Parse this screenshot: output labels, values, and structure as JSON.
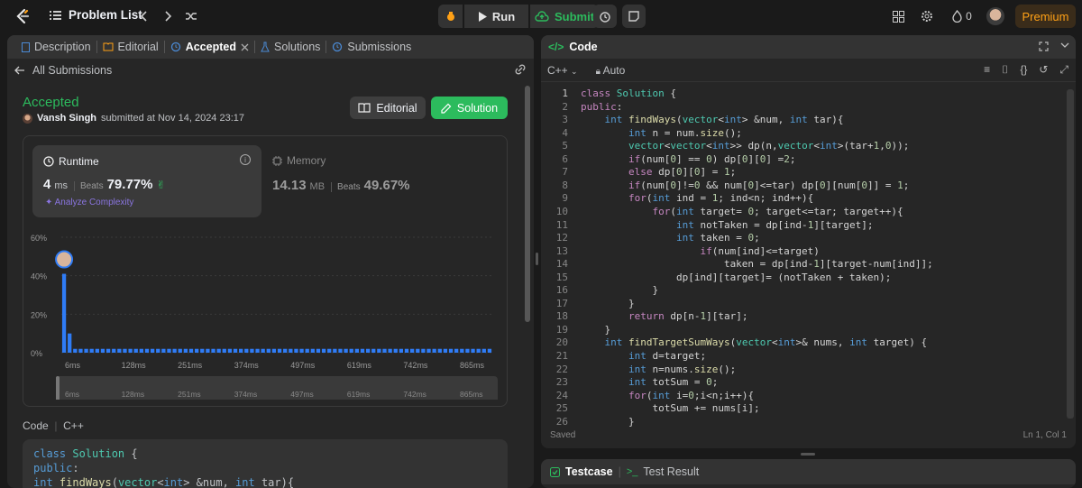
{
  "topbar": {
    "problem_list": "Problem List",
    "run": "Run",
    "submit": "Submit",
    "points": "0",
    "premium": "Premium"
  },
  "left": {
    "tabs": [
      "Description",
      "Editorial",
      "Accepted",
      "Solutions",
      "Submissions"
    ],
    "back_label": "All Submissions",
    "status": "Accepted",
    "user": "Vansh Singh",
    "submitted": "submitted at Nov 14, 2024 23:17",
    "editorial_btn": "Editorial",
    "solution_btn": "Solution",
    "runtime": {
      "title": "Runtime",
      "value": "4",
      "unit": "ms",
      "beats_label": "Beats",
      "beats": "79.77%",
      "analyze": "Analyze Complexity"
    },
    "memory": {
      "title": "Memory",
      "value": "14.13",
      "unit": "MB",
      "beats_label": "Beats",
      "beats": "49.67%"
    },
    "code_label": "Code",
    "code_lang": "C++",
    "code_preview": [
      "class Solution {",
      "public:",
      "    int findWays(vector<int> &num, int tar){"
    ]
  },
  "chart_data": {
    "type": "bar",
    "ylabels": [
      "60%",
      "40%",
      "20%",
      "0%"
    ],
    "ylim": [
      0,
      60
    ],
    "xlabels": [
      "6ms",
      "128ms",
      "251ms",
      "374ms",
      "497ms",
      "619ms",
      "742ms",
      "865ms"
    ],
    "values": [
      41,
      10,
      2,
      2,
      2,
      2,
      2,
      2,
      2,
      2,
      2,
      2,
      2,
      2,
      2,
      2,
      2,
      2,
      2,
      2,
      2,
      2,
      2,
      2,
      2,
      2,
      2,
      2,
      2,
      2,
      2,
      2,
      2,
      2,
      2,
      2,
      2,
      2,
      2,
      2,
      2,
      2,
      2,
      2,
      2,
      2,
      2,
      2,
      2,
      2,
      2,
      2,
      2,
      2,
      2,
      2,
      2,
      2,
      2,
      2,
      2,
      2,
      2,
      2,
      2,
      2,
      2,
      2,
      2,
      2,
      2,
      2,
      2,
      2,
      2,
      2,
      2,
      2
    ],
    "highlight_index": 0
  },
  "right": {
    "title": "Code",
    "lang": "C++",
    "auto": "Auto",
    "saved": "Saved",
    "cursor": "Ln 1, Col 1",
    "testcase": "Testcase",
    "test_result": "Test Result"
  },
  "code_lines": [
    "class Solution {",
    "public:",
    "    int findWays(vector<int> &num, int tar){",
    "        int n = num.size();",
    "        vector<vector<int>> dp(n,vector<int>(tar+1,0));",
    "        if(num[0] == 0) dp[0][0] =2;",
    "        else dp[0][0] = 1;",
    "        if(num[0]!=0 && num[0]<=tar) dp[0][num[0]] = 1;",
    "        for(int ind = 1; ind<n; ind++){",
    "            for(int target= 0; target<=tar; target++){",
    "                int notTaken = dp[ind-1][target];",
    "                int taken = 0;",
    "                    if(num[ind]<=target)",
    "                        taken = dp[ind-1][target-num[ind]];",
    "                dp[ind][target]= (notTaken + taken);",
    "            }",
    "        }",
    "        return dp[n-1][tar];",
    "    }",
    "    int findTargetSumWays(vector<int>& nums, int target) {",
    "        int d=target;",
    "        int n=nums.size();",
    "        int totSum = 0;",
    "        for(int i=0;i<n;i++){",
    "            totSum += nums[i];",
    "        }"
  ]
}
